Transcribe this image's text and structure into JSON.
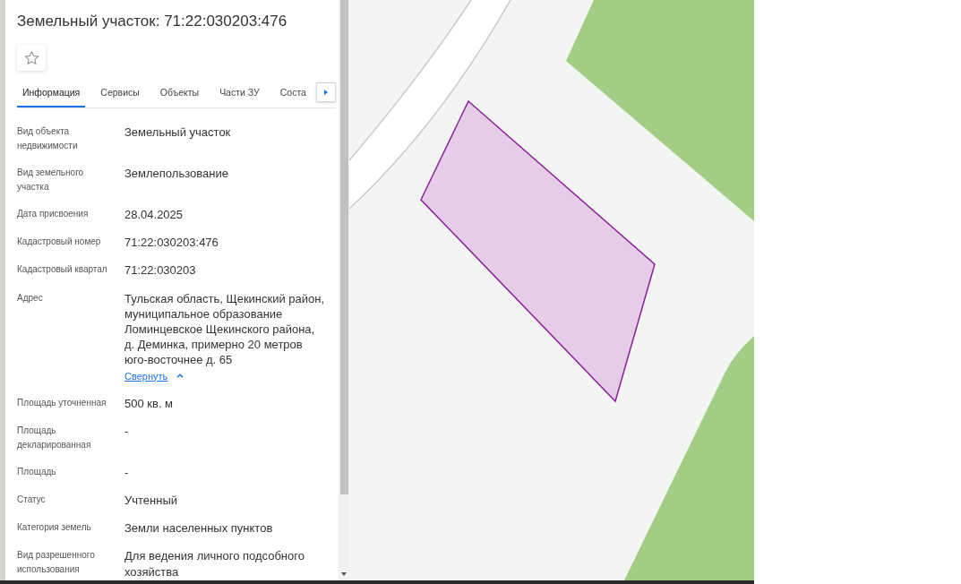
{
  "panel": {
    "title": "Земельный участок: 71:22:030203:476",
    "tabs": [
      {
        "label": "Информация",
        "selected": true
      },
      {
        "label": "Сервисы",
        "selected": false
      },
      {
        "label": "Объекты",
        "selected": false
      },
      {
        "label": "Части ЗУ",
        "selected": false
      },
      {
        "label": "Соста",
        "selected": false
      }
    ],
    "fields": [
      {
        "label": "Вид объекта недвижимости",
        "value": "Земельный участок"
      },
      {
        "label": "Вид земельного участка",
        "value": "Землепользование"
      },
      {
        "label": "Дата присвоения",
        "value": "28.04.2025"
      },
      {
        "label": "Кадастровый номер",
        "value": "71:22:030203:476"
      },
      {
        "label": "Кадастровый квартал",
        "value": "71:22:030203"
      },
      {
        "label": "Адрес",
        "value": "Тульская область, Щекинский район, муниципальное образование Ломинцевское Щекинского района, д. Деминка, примерно 20 метров юго-восточнее д. 65",
        "toggle": "Свернуть"
      },
      {
        "label": "Площадь уточненная",
        "value": "500 кв. м"
      },
      {
        "label": "Площадь декларированная",
        "value": "-"
      },
      {
        "label": "Площадь",
        "value": "-"
      },
      {
        "label": "Статус",
        "value": "Учтенный"
      },
      {
        "label": "Категория земель",
        "value": "Земли населенных пунктов"
      },
      {
        "label": "Вид разрешенного использования",
        "value": "Для ведения личного подсобного хозяйства"
      }
    ]
  }
}
